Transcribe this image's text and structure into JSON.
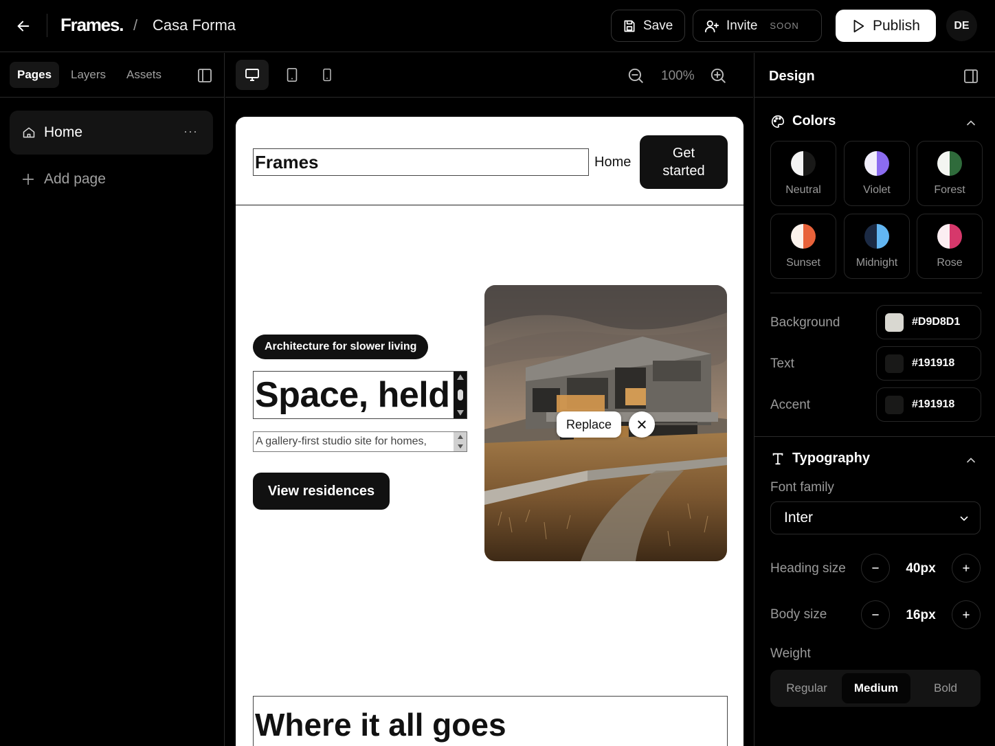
{
  "topbar": {
    "logo": "Frames.",
    "separator": "/",
    "project_name": "Casa Forma",
    "save_label": "Save",
    "invite_label": "Invite",
    "invite_badge": "SOON",
    "publish_label": "Publish",
    "avatar_initials": "DE"
  },
  "left_sidebar": {
    "tabs": [
      {
        "label": "Pages",
        "active": true
      },
      {
        "label": "Layers",
        "active": false
      },
      {
        "label": "Assets",
        "active": false
      }
    ],
    "pages": [
      {
        "label": "Home",
        "menu": "···"
      }
    ],
    "add_page_label": "Add page"
  },
  "toolbar": {
    "devices": [
      "desktop-icon",
      "tablet-icon",
      "mobile-icon"
    ],
    "active_device": "desktop",
    "zoom": "100%"
  },
  "canvas": {
    "site_brand": "Frames",
    "nav_home": "Home",
    "cta_label": "Get started",
    "hero_badge": "Architecture for slower living",
    "hero_title": "Space, held",
    "hero_subtitle": "A gallery-first studio site for homes,",
    "hero_button": "View residences",
    "image_replace": "Replace",
    "section_title": "Where it all goes"
  },
  "design_panel": {
    "title": "Design",
    "colors_title": "Colors",
    "palettes": [
      {
        "name": "Neutral",
        "left": "#f4f4f4",
        "right": "#191918"
      },
      {
        "name": "Violet",
        "left": "#f1eefb",
        "right": "#8b6cf0"
      },
      {
        "name": "Forest",
        "left": "#f3f5f1",
        "right": "#2f6b3b"
      },
      {
        "name": "Sunset",
        "left": "#fbf2ec",
        "right": "#e8623a"
      },
      {
        "name": "Midnight",
        "left": "#1b2a44",
        "right": "#62b6f2"
      },
      {
        "name": "Rose",
        "left": "#fbeef2",
        "right": "#d6386b"
      }
    ],
    "background_label": "Background",
    "background_value": "#D9D8D1",
    "text_label": "Text",
    "text_value": "#191918",
    "accent_label": "Accent",
    "accent_value": "#191918",
    "typography_title": "Typography",
    "font_family_label": "Font family",
    "font_family_value": "Inter",
    "heading_size_label": "Heading size",
    "heading_size_value": "40px",
    "body_size_label": "Body size",
    "body_size_value": "16px",
    "weight_label": "Weight",
    "weights": [
      "Regular",
      "Medium",
      "Bold"
    ],
    "active_weight": "Medium"
  }
}
